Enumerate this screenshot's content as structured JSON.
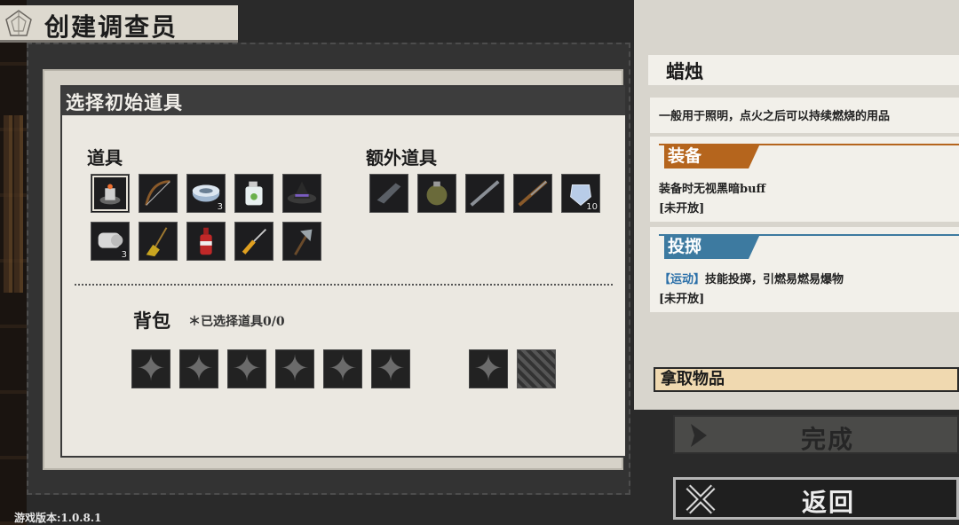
{
  "title": "创建调查员",
  "panel_title": "选择初始道具",
  "items_label": "道具",
  "extra_items_label": "额外道具",
  "items": [
    {
      "icon": "candle-icon",
      "qty": ""
    },
    {
      "icon": "bow-icon",
      "qty": ""
    },
    {
      "icon": "bandage-roll-icon",
      "qty": "3"
    },
    {
      "icon": "bottle-icon",
      "qty": ""
    },
    {
      "icon": "witch-hat-icon",
      "qty": ""
    },
    {
      "icon": "scroll-icon",
      "qty": "3"
    },
    {
      "icon": "broom-icon",
      "qty": ""
    },
    {
      "icon": "soda-bottle-icon",
      "qty": ""
    },
    {
      "icon": "screwdriver-icon",
      "qty": ""
    },
    {
      "icon": "axe-icon",
      "qty": ""
    }
  ],
  "extra_items": [
    {
      "icon": "pistol-icon",
      "qty": ""
    },
    {
      "icon": "grenade-icon",
      "qty": ""
    },
    {
      "icon": "rifle-icon",
      "qty": ""
    },
    {
      "icon": "shotgun-icon",
      "qty": ""
    },
    {
      "icon": "gem-icon",
      "qty": "10"
    }
  ],
  "bag_label": "背包",
  "bag_count": "＊已选择道具0/0",
  "info": {
    "name": "蜡烛",
    "description": "一般用于照明，点火之后可以持续燃烧的用品",
    "effects": [
      {
        "tag": "装备",
        "color": "#b5651d",
        "line1": "装备时无视黑暗buff",
        "line2": "[未开放]"
      },
      {
        "tag": "投掷",
        "color": "#3d7aa0",
        "line1_bracket": "【运动】",
        "line1": "技能投掷，引燃易燃易爆物",
        "line2": "[未开放]"
      }
    ],
    "take_label": "拿取物品"
  },
  "done_label": "完成",
  "back_label": "返回",
  "version": "游戏版本:1.0.8.1"
}
